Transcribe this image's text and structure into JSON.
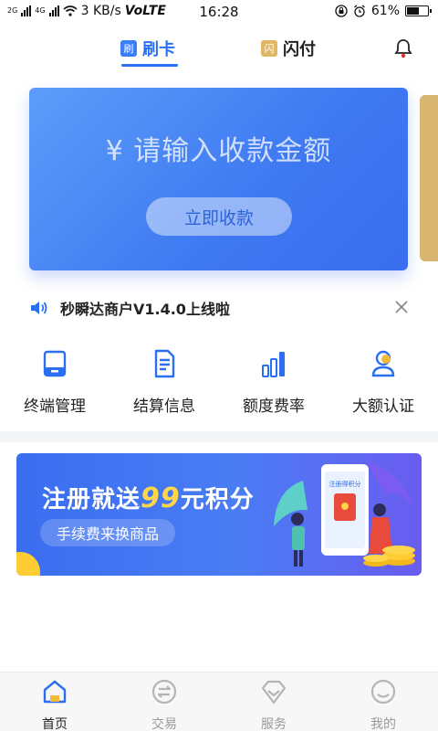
{
  "status_bar": {
    "network_small": "2G",
    "network_4g": "4G",
    "speed": "3 KB/s",
    "volte": "VoLTE",
    "time": "16:28",
    "battery": "61%",
    "battery_level": 0.61
  },
  "tabs": [
    {
      "badge": "刷",
      "label": "刷卡",
      "active": true
    },
    {
      "badge": "闪",
      "label": "闪付",
      "active": false
    }
  ],
  "card": {
    "amount_placeholder": "¥ 请输入收款金额",
    "button_label": "立即收款"
  },
  "notice": {
    "text": "秒瞬达商户V1.4.0上线啦"
  },
  "menu": [
    {
      "label": "终端管理",
      "icon": "terminal-icon"
    },
    {
      "label": "结算信息",
      "icon": "document-icon"
    },
    {
      "label": "额度费率",
      "icon": "bar-chart-icon"
    },
    {
      "label": "大额认证",
      "icon": "user-verify-icon"
    }
  ],
  "banner": {
    "title_before": "注册就送",
    "title_highlight": "99",
    "title_after": "元积分",
    "subtitle": "手续费来换商品",
    "phone_text": "注册得积分"
  },
  "bottom_nav": [
    {
      "label": "首页",
      "icon": "home-icon",
      "active": true
    },
    {
      "label": "交易",
      "icon": "exchange-icon",
      "active": false
    },
    {
      "label": "服务",
      "icon": "diamond-icon",
      "active": false
    },
    {
      "label": "我的",
      "icon": "profile-icon",
      "active": false
    }
  ],
  "colors": {
    "accent": "#2a6ff2",
    "gold": "#d9b66f",
    "banner_highlight": "#ffd54a"
  }
}
